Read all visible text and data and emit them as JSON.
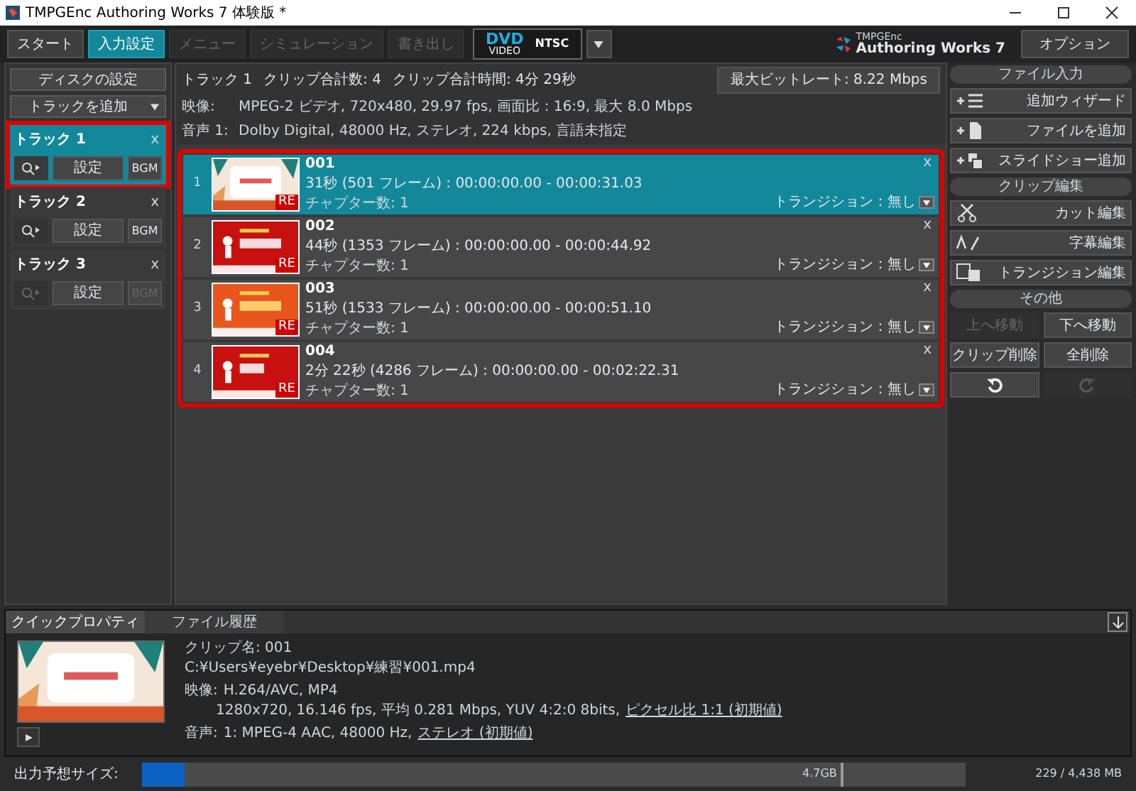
{
  "window": {
    "title": "TMPGEnc Authoring Works 7 体験版 *"
  },
  "steps": [
    {
      "label": "スタート",
      "selected": false,
      "disabled": false
    },
    {
      "label": "入力設定",
      "selected": true,
      "disabled": false
    },
    {
      "label": "メニュー",
      "selected": false,
      "disabled": true
    },
    {
      "label": "シミュレーション",
      "selected": false,
      "disabled": true
    },
    {
      "label": "書き出し",
      "selected": false,
      "disabled": true
    }
  ],
  "format": {
    "disc": "DVD",
    "sub": "VIDEO",
    "standard": "NTSC"
  },
  "logo": {
    "brand": "TMPGEnc",
    "product": "Authoring Works 7"
  },
  "options_button": "オプション",
  "left_panel": {
    "disc_settings": "ディスクの設定",
    "add_track": "トラックを追加",
    "tracks": [
      {
        "title": "トラック 1",
        "selected": true,
        "highlighted": true,
        "close": "x",
        "settings": "設定",
        "bgm": "BGM",
        "disabled": false
      },
      {
        "title": "トラック 2",
        "selected": false,
        "highlighted": false,
        "close": "x",
        "settings": "設定",
        "bgm": "BGM",
        "disabled": false
      },
      {
        "title": "トラック 3",
        "selected": false,
        "highlighted": false,
        "close": "x",
        "settings": "設定",
        "bgm": "BGM",
        "disabled": true
      }
    ]
  },
  "summary": {
    "track": "トラック 1",
    "count_label": "クリップ合計数:",
    "count": "4",
    "time_label": "クリップ合計時間:",
    "time": "4分 29秒",
    "max_bitrate": "最大ビットレート: 8.22 Mbps",
    "video_label": "映像:",
    "video": "MPEG-2 ビデオ,  720x480,  29.97 fps,  画面比：16:9,  最大 8.0 Mbps",
    "audio_label": "音声 1:",
    "audio": "Dolby Digital,  48000 Hz,  ステレオ,  224 kbps,  言語未指定"
  },
  "clips_highlighted": true,
  "clips": [
    {
      "index": "1",
      "name": "001",
      "duration": "31秒 (501 フレーム) :  00:00:00.00 - 00:00:31.03",
      "chapters": "チャプター数: 1",
      "transition": "トランジション：無し",
      "badge": "RE",
      "close": "x",
      "selected": true
    },
    {
      "index": "2",
      "name": "002",
      "duration": "44秒 (1353 フレーム) :  00:00:00.00 - 00:00:44.92",
      "chapters": "チャプター数: 1",
      "transition": "トランジション：無し",
      "badge": "RE",
      "close": "x",
      "selected": false
    },
    {
      "index": "3",
      "name": "003",
      "duration": "51秒 (1533 フレーム) :  00:00:00.00 - 00:00:51.10",
      "chapters": "チャプター数: 1",
      "transition": "トランジション：無し",
      "badge": "RE",
      "close": "x",
      "selected": false
    },
    {
      "index": "4",
      "name": "004",
      "duration": "2分 22秒 (4286 フレーム) :  00:00:00.00 - 00:02:22.31",
      "chapters": "チャプター数: 1",
      "transition": "トランジション：無し",
      "badge": "RE",
      "close": "x",
      "selected": false
    }
  ],
  "right_panel": [
    {
      "title": "ファイル入力",
      "buttons": [
        {
          "label": "追加ウィザード",
          "kind": "wizard",
          "disabled": false
        },
        {
          "label": "ファイルを追加",
          "kind": "file",
          "disabled": false
        },
        {
          "label": "スライドショー追加",
          "kind": "slideshow",
          "disabled": false
        }
      ]
    },
    {
      "title": "クリップ編集",
      "buttons": [
        {
          "label": "カット編集",
          "kind": "cut",
          "disabled": false
        },
        {
          "label": "字幕編集",
          "kind": "subtitle",
          "disabled": false
        },
        {
          "label": "トランジション編集",
          "kind": "transition",
          "disabled": false
        }
      ]
    },
    {
      "title": "その他",
      "buttons": [
        {
          "label": "上へ移動",
          "kind": "half",
          "disabled": true
        },
        {
          "label": "下へ移動",
          "kind": "half",
          "disabled": false
        },
        {
          "label": "クリップ削除",
          "kind": "half",
          "disabled": false
        },
        {
          "label": "全削除",
          "kind": "half",
          "disabled": false
        },
        {
          "kind": "undo",
          "disabled": false
        },
        {
          "kind": "redo",
          "disabled": true
        }
      ]
    }
  ],
  "bottom_panel": {
    "tabs": [
      {
        "label": "クイックプロパティ",
        "selected": true
      },
      {
        "label": "ファイル履歴",
        "selected": false
      }
    ],
    "clip_name": "クリップ名:  001",
    "path": "C:¥Users¥eyebr¥Desktop¥練習¥001.mp4",
    "video_label": "映像:",
    "video_1": "H.264/AVC,  MP4",
    "video_2": "1280x720,  16.146 fps,  平均 0.281 Mbps,  YUV 4:2:0 8bits,",
    "video_link": "ピクセル比 1:1 (初期値)",
    "audio_label": "音声:",
    "audio": "1:  MPEG-4 AAC, 48000 Hz,",
    "audio_link": "ステレオ (初期値)"
  },
  "output": {
    "label": "出力予想サイズ:",
    "level": 0.052,
    "marker": "4.7GB",
    "reading": "229 / 4,438 MB"
  }
}
